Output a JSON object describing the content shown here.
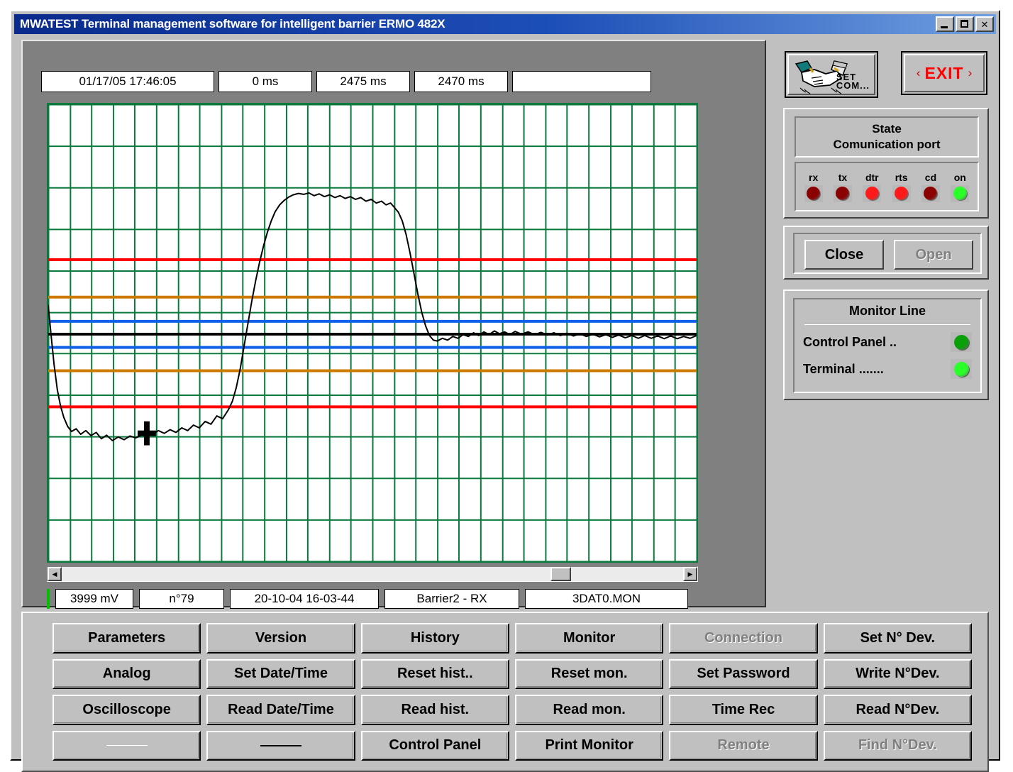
{
  "window": {
    "title": "MWATEST Terminal management software for intelligent barrier ERMO 482X",
    "minimize_label": "_",
    "maximize_label": "□",
    "close_label": "✕"
  },
  "scope": {
    "top_fields": [
      {
        "name": "timestamp",
        "value": "01/17/05 17:46:05"
      },
      {
        "name": "start-time",
        "value": "0 ms"
      },
      {
        "name": "end-time",
        "value": "2475 ms"
      },
      {
        "name": "span-time",
        "value": "2470 ms"
      },
      {
        "name": "extra",
        "value": ""
      }
    ],
    "bottom_fields": [
      {
        "name": "voltage",
        "value": "3999 mV"
      },
      {
        "name": "sample-number",
        "value": "n°79"
      },
      {
        "name": "record-datetime",
        "value": "20-10-04 16-03-44"
      },
      {
        "name": "channel",
        "value": "Barrier2 - RX"
      },
      {
        "name": "filename",
        "value": "3DAT0.MON"
      }
    ],
    "scrollbar": {
      "left_arrow": "◀",
      "right_arrow": "▶",
      "thumb_position_pct": 78.6
    }
  },
  "chart_data": {
    "type": "line",
    "title": "",
    "xlabel": "",
    "ylabel": "",
    "xlim": [
      0,
      2475
    ],
    "ylim": [
      0,
      4095
    ],
    "grid": true,
    "grid_color": "#0a7a3c",
    "grid_vertical_divisions": 30,
    "grid_horizontal_divisions": 11,
    "background": "#ffffff",
    "trace_color": "#000000",
    "threshold_lines": [
      {
        "name": "upper-alarm",
        "color": "#ff0000",
        "y_pct": 34.0
      },
      {
        "name": "upper-warning",
        "color": "#cc7a00",
        "y_pct": 42.2
      },
      {
        "name": "upper-band",
        "color": "#1060e8",
        "y_pct": 47.5
      },
      {
        "name": "baseline",
        "color": "#000000",
        "y_pct": 50.3
      },
      {
        "name": "lower-band",
        "color": "#1060e8",
        "y_pct": 53.2
      },
      {
        "name": "lower-warning",
        "color": "#cc7a00",
        "y_pct": 58.3
      },
      {
        "name": "lower-alarm",
        "color": "#ff0000",
        "y_pct": 66.2
      }
    ],
    "cursor": {
      "x_pct": 15.2,
      "y_pct": 72.0,
      "label": "+"
    },
    "series": [
      {
        "name": "barrier2-rx",
        "points_pct": [
          [
            0.0,
            44.0
          ],
          [
            0.4,
            50.0
          ],
          [
            0.9,
            57.0
          ],
          [
            1.4,
            62.5
          ],
          [
            1.9,
            66.0
          ],
          [
            2.4,
            68.5
          ],
          [
            3.0,
            70.5
          ],
          [
            3.6,
            71.6
          ],
          [
            4.3,
            71.0
          ],
          [
            5.0,
            72.2
          ],
          [
            5.8,
            71.4
          ],
          [
            6.6,
            72.5
          ],
          [
            7.4,
            71.8
          ],
          [
            8.2,
            73.2
          ],
          [
            9.0,
            72.4
          ],
          [
            9.9,
            73.6
          ],
          [
            10.8,
            72.8
          ],
          [
            11.7,
            73.4
          ],
          [
            12.6,
            72.6
          ],
          [
            13.5,
            73.0
          ],
          [
            14.4,
            72.4
          ],
          [
            15.2,
            72.6
          ],
          [
            16.1,
            72.2
          ],
          [
            17.0,
            71.4
          ],
          [
            17.9,
            72.0
          ],
          [
            18.8,
            71.2
          ],
          [
            19.7,
            71.8
          ],
          [
            20.6,
            70.8
          ],
          [
            21.5,
            71.4
          ],
          [
            22.4,
            70.2
          ],
          [
            23.3,
            70.8
          ],
          [
            24.2,
            69.4
          ],
          [
            25.1,
            70.0
          ],
          [
            26.0,
            68.2
          ],
          [
            26.9,
            68.8
          ],
          [
            27.8,
            66.8
          ],
          [
            28.4,
            65.0
          ],
          [
            29.0,
            62.0
          ],
          [
            29.6,
            58.0
          ],
          [
            30.2,
            53.0
          ],
          [
            30.8,
            48.0
          ],
          [
            31.4,
            43.0
          ],
          [
            32.0,
            38.5
          ],
          [
            32.6,
            34.5
          ],
          [
            33.2,
            31.0
          ],
          [
            33.8,
            28.0
          ],
          [
            34.4,
            25.5
          ],
          [
            35.0,
            23.5
          ],
          [
            35.7,
            22.0
          ],
          [
            36.4,
            21.0
          ],
          [
            37.1,
            20.3
          ],
          [
            37.8,
            19.8
          ],
          [
            38.6,
            19.5
          ],
          [
            39.4,
            19.7
          ],
          [
            40.2,
            19.4
          ],
          [
            41.0,
            20.0
          ],
          [
            41.8,
            19.6
          ],
          [
            42.6,
            20.2
          ],
          [
            43.4,
            19.8
          ],
          [
            44.2,
            20.4
          ],
          [
            45.0,
            20.0
          ],
          [
            45.8,
            20.6
          ],
          [
            46.6,
            20.2
          ],
          [
            47.4,
            20.8
          ],
          [
            48.2,
            20.4
          ],
          [
            49.0,
            21.2
          ],
          [
            49.8,
            20.8
          ],
          [
            50.6,
            21.6
          ],
          [
            51.4,
            21.2
          ],
          [
            52.1,
            22.0
          ],
          [
            52.8,
            21.6
          ],
          [
            53.4,
            22.6
          ],
          [
            54.0,
            23.6
          ],
          [
            54.6,
            25.5
          ],
          [
            55.2,
            28.5
          ],
          [
            55.8,
            32.5
          ],
          [
            56.4,
            37.0
          ],
          [
            57.0,
            41.5
          ],
          [
            57.6,
            45.5
          ],
          [
            58.2,
            48.5
          ],
          [
            58.8,
            50.6
          ],
          [
            59.4,
            51.6
          ],
          [
            60.0,
            51.8
          ],
          [
            60.8,
            51.2
          ],
          [
            61.6,
            51.6
          ],
          [
            62.4,
            50.8
          ],
          [
            63.2,
            51.2
          ],
          [
            64.0,
            50.4
          ],
          [
            64.8,
            50.8
          ],
          [
            65.6,
            50.0
          ],
          [
            66.4,
            50.6
          ],
          [
            67.2,
            49.8
          ],
          [
            68.0,
            50.4
          ],
          [
            68.8,
            49.6
          ],
          [
            69.6,
            50.2
          ],
          [
            70.4,
            49.8
          ],
          [
            71.2,
            50.4
          ],
          [
            72.0,
            49.7
          ],
          [
            73.0,
            50.3
          ],
          [
            74.0,
            49.8
          ],
          [
            75.0,
            50.4
          ],
          [
            76.0,
            49.9
          ],
          [
            77.0,
            50.5
          ],
          [
            78.0,
            50.0
          ],
          [
            79.0,
            50.6
          ],
          [
            80.0,
            50.1
          ],
          [
            81.0,
            50.7
          ],
          [
            82.0,
            50.2
          ],
          [
            83.0,
            50.8
          ],
          [
            84.0,
            50.3
          ],
          [
            85.0,
            50.9
          ],
          [
            86.0,
            50.4
          ],
          [
            87.0,
            51.0
          ],
          [
            88.0,
            50.5
          ],
          [
            89.0,
            51.1
          ],
          [
            90.0,
            50.6
          ],
          [
            91.0,
            51.2
          ],
          [
            92.0,
            50.6
          ],
          [
            93.0,
            51.2
          ],
          [
            94.0,
            50.7
          ],
          [
            95.0,
            51.3
          ],
          [
            96.0,
            50.7
          ],
          [
            97.0,
            51.3
          ],
          [
            98.0,
            50.8
          ],
          [
            99.0,
            51.2
          ],
          [
            100.0,
            50.6
          ]
        ]
      }
    ]
  },
  "side_panel": {
    "setcom": {
      "label_line1": "SET",
      "label_line2": "COM...",
      "icon": "handshake-icon"
    },
    "exit": {
      "left_chevron": "‹",
      "label": "EXIT",
      "right_chevron": "›"
    },
    "comm_state": {
      "title_line1": "State",
      "title_line2": "Comunication port",
      "leds": [
        {
          "name": "rx",
          "label": "rx",
          "color": "#8b0000",
          "state": "off"
        },
        {
          "name": "tx",
          "label": "tx",
          "color": "#8b0000",
          "state": "off"
        },
        {
          "name": "dtr",
          "label": "dtr",
          "color": "#ff1a1a",
          "state": "on"
        },
        {
          "name": "rts",
          "label": "rts",
          "color": "#ff1a1a",
          "state": "on"
        },
        {
          "name": "cd",
          "label": "cd",
          "color": "#8b0000",
          "state": "off"
        },
        {
          "name": "on",
          "label": "on",
          "color": "#2aff2a",
          "state": "on"
        }
      ]
    },
    "port_buttons": [
      {
        "name": "close",
        "label": "Close",
        "enabled": true
      },
      {
        "name": "open",
        "label": "Open",
        "enabled": false
      }
    ],
    "monitor_line": {
      "title": "Monitor Line",
      "rows": [
        {
          "name": "control-panel",
          "label": "Control Panel ..",
          "color": "#0aa00a",
          "state": "on"
        },
        {
          "name": "terminal",
          "label": "Terminal   .......",
          "color": "#2aff2a",
          "state": "on"
        }
      ]
    }
  },
  "buttons": [
    {
      "name": "parameters",
      "label": "Parameters",
      "enabled": true
    },
    {
      "name": "version",
      "label": "Version",
      "enabled": true
    },
    {
      "name": "history",
      "label": "History",
      "enabled": true
    },
    {
      "name": "monitor",
      "label": "Monitor",
      "enabled": true
    },
    {
      "name": "connection",
      "label": "Connection",
      "enabled": false
    },
    {
      "name": "set-n-dev",
      "label": "Set N° Dev.",
      "enabled": true
    },
    {
      "name": "analog",
      "label": "Analog",
      "enabled": true
    },
    {
      "name": "set-date-time",
      "label": "Set Date/Time",
      "enabled": true
    },
    {
      "name": "reset-hist",
      "label": "Reset hist..",
      "enabled": true
    },
    {
      "name": "reset-mon",
      "label": "Reset mon.",
      "enabled": true
    },
    {
      "name": "set-password",
      "label": "Set Password",
      "enabled": true
    },
    {
      "name": "write-n-dev",
      "label": "Write N°Dev.",
      "enabled": true
    },
    {
      "name": "oscilloscope",
      "label": "Oscilloscope",
      "enabled": true
    },
    {
      "name": "read-date-time",
      "label": "Read Date/Time",
      "enabled": true
    },
    {
      "name": "read-hist",
      "label": "Read hist.",
      "enabled": true
    },
    {
      "name": "read-mon",
      "label": "Read mon.",
      "enabled": true
    },
    {
      "name": "time-rec",
      "label": "Time Rec",
      "enabled": true
    },
    {
      "name": "read-n-dev",
      "label": "Read N°Dev.",
      "enabled": true
    },
    {
      "name": "blank-1",
      "label": "",
      "enabled": false,
      "dash": "light"
    },
    {
      "name": "blank-2",
      "label": "",
      "enabled": true,
      "dash": "dark"
    },
    {
      "name": "control-panel",
      "label": "Control Panel",
      "enabled": true
    },
    {
      "name": "print-monitor",
      "label": "Print Monitor",
      "enabled": true
    },
    {
      "name": "remote",
      "label": "Remote",
      "enabled": false
    },
    {
      "name": "find-n-dev",
      "label": "Find N°Dev.",
      "enabled": false
    }
  ]
}
